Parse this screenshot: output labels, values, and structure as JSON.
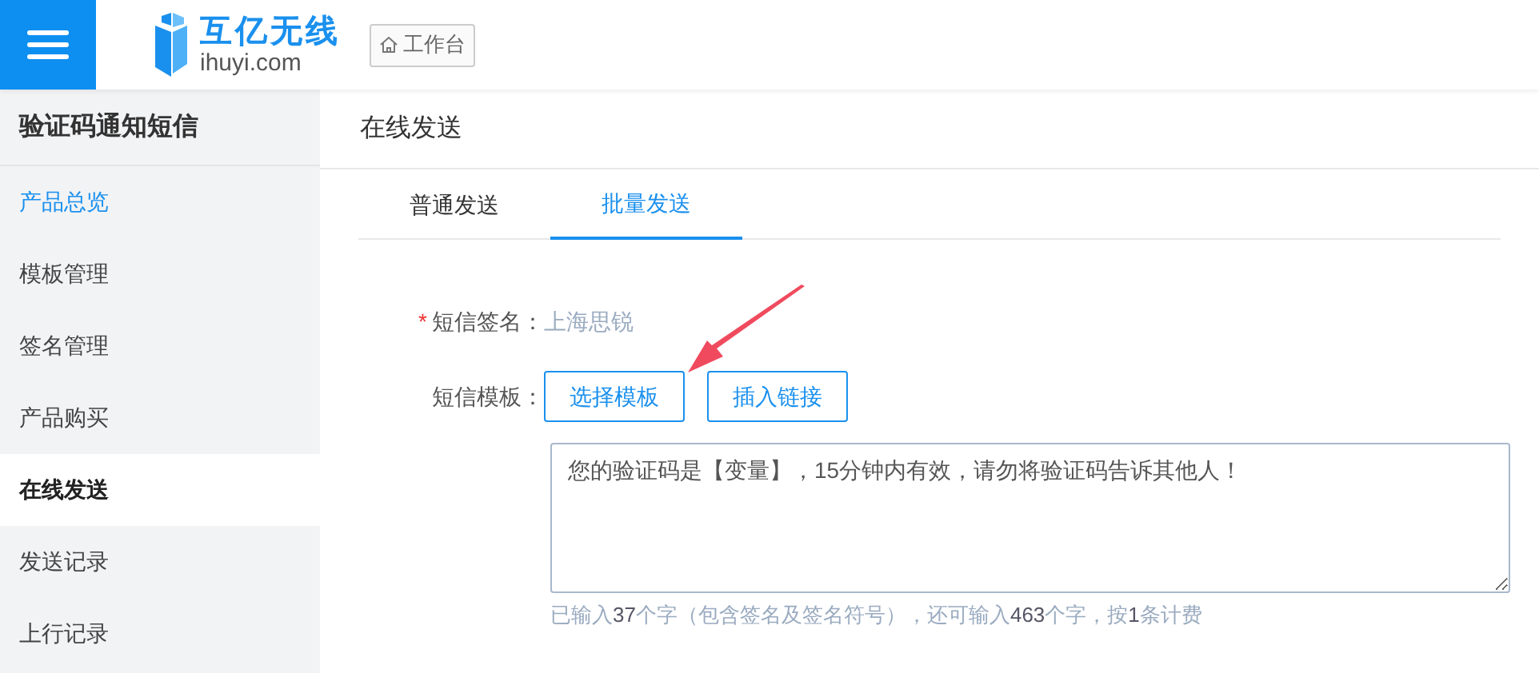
{
  "header": {
    "logo_name": "互亿无线",
    "logo_domain": "ihuyi.com",
    "workbench_button": "工作台"
  },
  "sidebar": {
    "title": "验证码通知短信",
    "items": [
      {
        "label": "产品总览",
        "selected": false,
        "hovered": true
      },
      {
        "label": "模板管理",
        "selected": false,
        "hovered": false
      },
      {
        "label": "签名管理",
        "selected": false,
        "hovered": false
      },
      {
        "label": "产品购买",
        "selected": false,
        "hovered": false
      },
      {
        "label": "在线发送",
        "selected": true,
        "hovered": false
      },
      {
        "label": "发送记录",
        "selected": false,
        "hovered": false
      },
      {
        "label": "上行记录",
        "selected": false,
        "hovered": false
      }
    ]
  },
  "page_title": "在线发送",
  "tabs": [
    {
      "label": "普通发送",
      "selected": false
    },
    {
      "label": "批量发送",
      "selected": true
    }
  ],
  "form": {
    "signature_label": "短信签名：",
    "required_mark": "*",
    "signature_value": "上海思锐",
    "template_label": "短信模板：",
    "buttons": [
      "选择模板",
      "插入链接"
    ],
    "message": "您的验证码是【变量】，15分钟内有效，请勿将验证码告诉其他人！",
    "hint": "已输入**37**个字（包含签名及签名符号），还可输入**463**个字，按**1**条计费"
  },
  "annotation": {
    "kind": "arrow"
  }
}
